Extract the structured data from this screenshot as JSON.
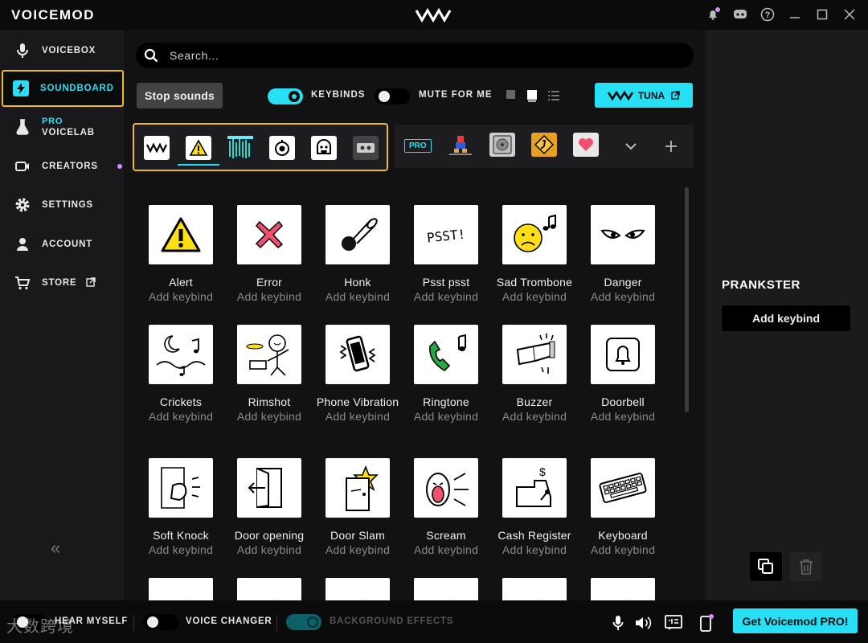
{
  "app": {
    "brand": "VOICEMOD"
  },
  "sidebar": {
    "items": [
      {
        "label": "VOICEBOX"
      },
      {
        "label": "SOUNDBOARD"
      },
      {
        "pro": "PRO",
        "label": "VOICELAB"
      },
      {
        "label": "CREATORS"
      },
      {
        "label": "SETTINGS"
      },
      {
        "label": "ACCOUNT"
      },
      {
        "label": "STORE"
      }
    ],
    "collapse": "«"
  },
  "toolbar": {
    "search_placeholder": "Search...",
    "stop_sounds": "Stop sounds",
    "keybinds_label": "KEYBINDS",
    "keybinds_on": true,
    "mute_label": "MUTE FOR ME",
    "mute_on": false,
    "tuna_label": "TUNA"
  },
  "categories": {
    "pro_badge": "PRO"
  },
  "sounds": [
    {
      "name": "Alert",
      "keybind": "Add keybind",
      "icon": "warning-icon"
    },
    {
      "name": "Error",
      "keybind": "Add keybind",
      "icon": "x-icon"
    },
    {
      "name": "Honk",
      "keybind": "Add keybind",
      "icon": "horn-icon"
    },
    {
      "name": "Psst psst",
      "keybind": "Add keybind",
      "icon": "psst-icon"
    },
    {
      "name": "Sad Trombone",
      "keybind": "Add keybind",
      "icon": "sad-face-icon"
    },
    {
      "name": "Danger",
      "keybind": "Add keybind",
      "icon": "eyes-icon"
    },
    {
      "name": "Crickets",
      "keybind": "Add keybind",
      "icon": "moon-icon"
    },
    {
      "name": "Rimshot",
      "keybind": "Add keybind",
      "icon": "drummer-icon"
    },
    {
      "name": "Phone Vibration",
      "keybind": "Add keybind",
      "icon": "phone-icon"
    },
    {
      "name": "Ringtone",
      "keybind": "Add keybind",
      "icon": "ringtone-icon"
    },
    {
      "name": "Buzzer",
      "keybind": "Add keybind",
      "icon": "buzzer-icon"
    },
    {
      "name": "Doorbell",
      "keybind": "Add keybind",
      "icon": "doorbell-icon"
    },
    {
      "name": "Soft Knock",
      "keybind": "Add keybind",
      "icon": "knock-icon"
    },
    {
      "name": "Door opening",
      "keybind": "Add keybind",
      "icon": "door-icon"
    },
    {
      "name": "Door Slam",
      "keybind": "Add keybind",
      "icon": "door-slam-icon"
    },
    {
      "name": "Scream",
      "keybind": "Add keybind",
      "icon": "scream-icon"
    },
    {
      "name": "Cash Register",
      "keybind": "Add keybind",
      "icon": "cash-register-icon"
    },
    {
      "name": "Keyboard",
      "keybind": "Add keybind",
      "icon": "keyboard-icon"
    }
  ],
  "right_panel": {
    "title": "PRANKSTER",
    "add_keybind": "Add keybind"
  },
  "bottom": {
    "hear_myself": "HEAR MYSELF",
    "voice_changer": "VOICE CHANGER",
    "background_effects": "BACKGROUND EFFECTS",
    "get_pro": "Get Voicemod PRO!",
    "watermark": "大数跨境"
  },
  "colors": {
    "accent": "#27e0f5",
    "highlight": "#f2b82c",
    "notify": "#d98cff"
  }
}
